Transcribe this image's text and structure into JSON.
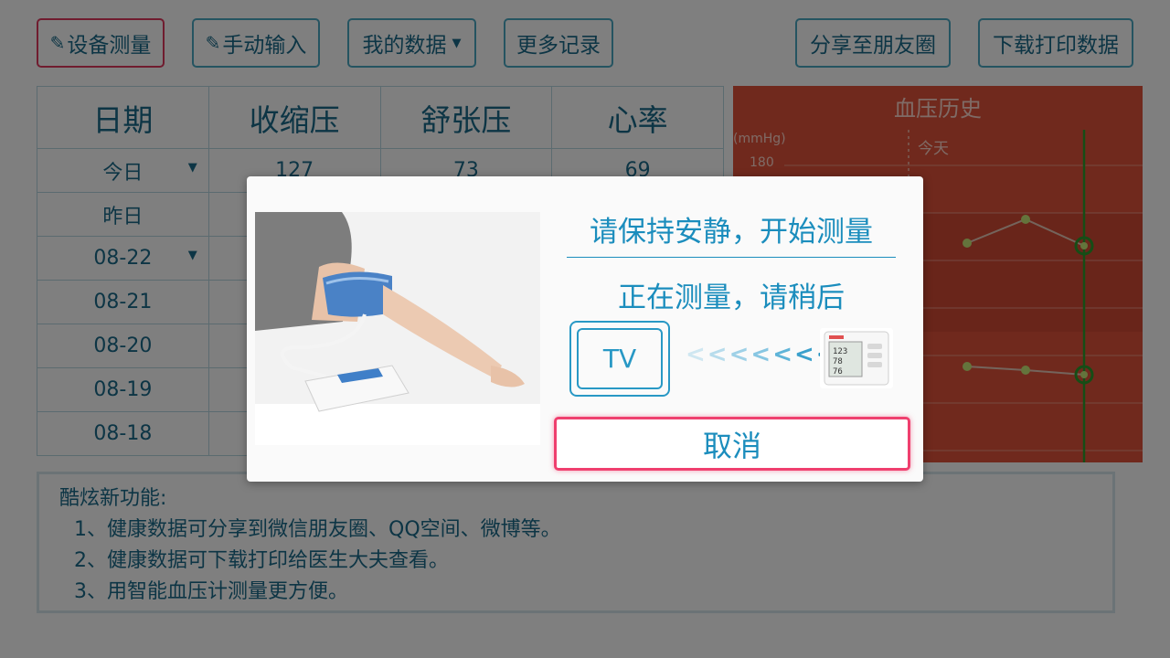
{
  "toolbar": {
    "device_measure": "设备测量",
    "manual_input": "手动输入",
    "my_data": "我的数据",
    "more_records": "更多记录",
    "share_moments": "分享至朋友圈",
    "download_print": "下载打印数据"
  },
  "table": {
    "headers": [
      "日期",
      "收缩压",
      "舒张压",
      "心率"
    ],
    "rows": [
      {
        "date": "今日",
        "systolic": "127",
        "diastolic": "73",
        "heart_rate": "69"
      },
      {
        "date": "昨日",
        "systolic": "",
        "diastolic": "",
        "heart_rate": ""
      },
      {
        "date": "08-22",
        "systolic": "",
        "diastolic": "",
        "heart_rate": ""
      },
      {
        "date": "08-21",
        "systolic": "",
        "diastolic": "",
        "heart_rate": ""
      },
      {
        "date": "08-20",
        "systolic": "",
        "diastolic": "",
        "heart_rate": ""
      },
      {
        "date": "08-19",
        "systolic": "",
        "diastolic": "",
        "heart_rate": ""
      },
      {
        "date": "08-18",
        "systolic": "",
        "diastolic": "",
        "heart_rate": ""
      }
    ]
  },
  "chart": {
    "title": "血压历史",
    "unit_label": "(mmHg)",
    "tick_label": "180",
    "today_label": "今天"
  },
  "info": {
    "heading": "酷炫新功能:",
    "items": [
      "1、健康数据可分享到微信朋友圈、QQ空间、微博等。",
      "2、健康数据可下载打印给医生大夫查看。",
      "3、用智能血压计测量更方便。"
    ]
  },
  "dialog": {
    "title": "请保持安静，开始测量",
    "status": "正在测量，请稍后",
    "tv_label": "TV",
    "cancel_label": "取消"
  },
  "colors": {
    "accent": "#1b8dbd",
    "active_border": "#e0385e",
    "chart_bg": "#e0533b",
    "cursor_line": "#2d9a2d"
  },
  "icons": {
    "device_measure": "pen-icon",
    "manual_input": "pencil-icon",
    "my_data": "chevron-down-icon"
  }
}
